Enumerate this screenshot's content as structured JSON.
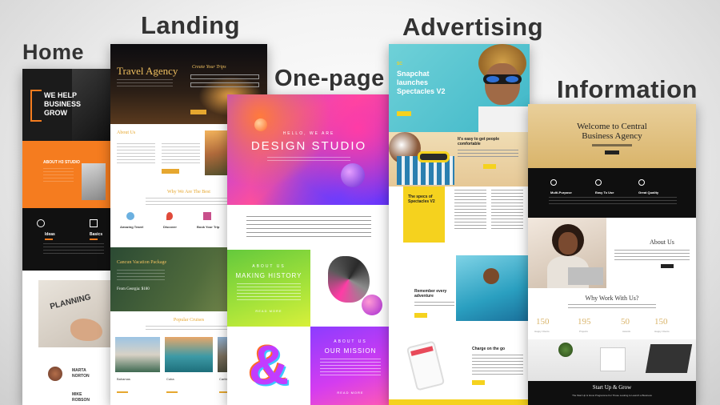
{
  "categories": {
    "home": "Home",
    "landing": "Landing",
    "onepage": "One-page",
    "advertising": "Advertising",
    "information": "Information"
  },
  "home": {
    "hero_line1": "WE HELP",
    "hero_line2": "BUSINESS",
    "hero_line3": "GROW",
    "studio_heading": "ABOUT H3 STUDIO",
    "feature1": "Ideas",
    "feature2": "Basics",
    "planning_word": "PLANNING",
    "person1_line1": "MARTA",
    "person1_line2": "NORTON",
    "person2_line1": "MIKE",
    "person2_line2": "ROBSON",
    "accent_color": "#f57c1f"
  },
  "landing": {
    "brand": "Travel Agency",
    "form_title": "Create Your Trips",
    "about_heading": "About Us",
    "why_heading": "Why We Are The Best",
    "feature1": "Amazing Travel",
    "feature2": "Discover",
    "feature3": "Book Your Trip",
    "package_heading": "Cancun Vacation Package",
    "package_price": "From Georgia: $180",
    "cruises_heading": "Popular Cruises",
    "dest1": "Bahamas",
    "dest2": "Cuba",
    "dest3": "Caribbean",
    "accent_color": "#e6a72f"
  },
  "onepage": {
    "kicker": "HELLO, WE ARE",
    "title": "DESIGN STUDIO",
    "history_kicker": "ABOUT US",
    "history_title": "MAKING HISTORY",
    "read_more": "READ MORE",
    "mission_kicker": "ABOUT US",
    "mission_title": "OUR MISSION",
    "read_more_2": "READ MORE"
  },
  "advertising": {
    "logo": "SC",
    "headline": "Snapchat launches Spectacles V2",
    "button": "Buy Now",
    "promo_title": "It's easy to get people comfortable",
    "specs_title": "The specs of Spectacles V2",
    "remember_title": "Remember every adventure",
    "charge_title": "Charge on the go",
    "accent_color": "#f5d21e"
  },
  "information": {
    "title_line1": "Welcome to Central",
    "title_line2": "Business Agency",
    "feature1": "Multi-Purpose",
    "feature2": "Easy To Use",
    "feature3": "Great Quality",
    "about_heading": "About Us",
    "why_heading": "Why Work With Us?",
    "stats": [
      "150",
      "195",
      "50",
      "150"
    ],
    "stat_labels": [
      "Happy Clients",
      "Projects",
      "Awards",
      "Happy Clients"
    ],
    "footer_heading": "Start Up & Grow",
    "footer_sub": "The Start Up & Grow Programme For Those Looking to Launch a Business",
    "accent_color": "#d9b46a"
  }
}
